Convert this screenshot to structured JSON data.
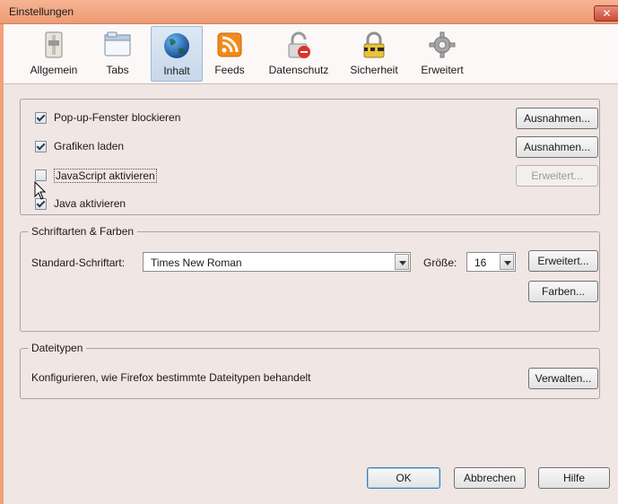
{
  "window": {
    "title": "Einstellungen",
    "close_glyph": "✕"
  },
  "tabs": [
    {
      "label": "Allgemein",
      "icon": "general-switch-icon"
    },
    {
      "label": "Tabs",
      "icon": "tabs-window-icon"
    },
    {
      "label": "Inhalt",
      "icon": "globe-icon",
      "active": true
    },
    {
      "label": "Feeds",
      "icon": "rss-feed-icon"
    },
    {
      "label": "Datenschutz",
      "icon": "privacy-mask-icon"
    },
    {
      "label": "Sicherheit",
      "icon": "padlock-icon"
    },
    {
      "label": "Erweitert",
      "icon": "gear-icon"
    }
  ],
  "content": {
    "popups": {
      "label": "Pop-up-Fenster blockieren",
      "checked": true,
      "button": "Ausnahmen..."
    },
    "images": {
      "label": "Grafiken laden",
      "checked": true,
      "button": "Ausnahmen..."
    },
    "javascript": {
      "label": "JavaScript aktivieren",
      "checked": false,
      "button": "Erweitert...",
      "button_disabled": true
    },
    "java": {
      "label": "Java aktivieren",
      "checked": true
    }
  },
  "fonts": {
    "legend": "Schriftarten & Farben",
    "default_font_label": "Standard-Schriftart:",
    "default_font_value": "Times New Roman",
    "size_label": "Größe:",
    "size_value": "16",
    "advanced_button": "Erweitert...",
    "colors_button": "Farben..."
  },
  "filetypes": {
    "legend": "Dateitypen",
    "description": "Konfigurieren, wie Firefox bestimmte Dateitypen behandelt",
    "manage_button": "Verwalten..."
  },
  "footer": {
    "ok": "OK",
    "cancel": "Abbrechen",
    "help": "Hilfe"
  },
  "colors": {
    "titlebar": "#f1a17c",
    "dialog_bg": "#f0e6e3",
    "active_tab": "#c7d7ea"
  }
}
